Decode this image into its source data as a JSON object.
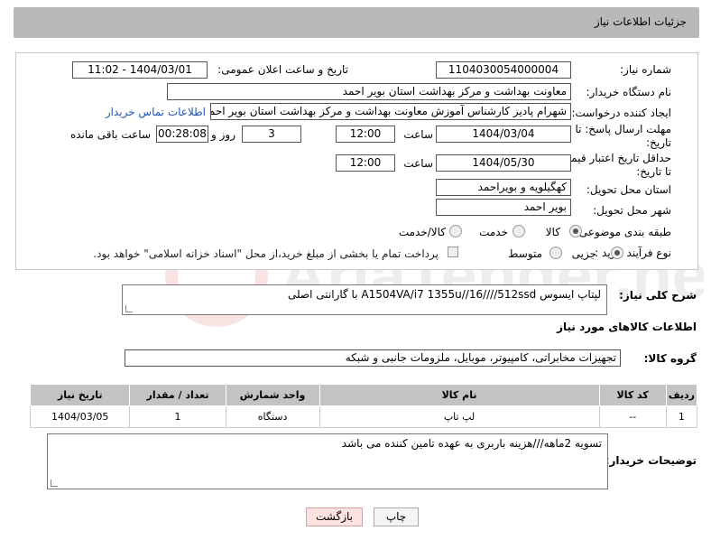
{
  "header": {
    "title": "جزئیات اطلاعات نیاز"
  },
  "form": {
    "need_number_label": "شماره نیاز:",
    "need_number": "1104030054000004",
    "announce_label": "تاریخ و ساعت اعلان عمومی:",
    "announce_value": "1404/03/01 - 11:02",
    "buyer_label": "نام دستگاه خریدار:",
    "buyer_value": "معاونت بهداشت و مرکز بهداشت استان بویر احمد",
    "creator_label": "ایجاد کننده درخواست:",
    "creator_value": "شهرام پادیز کارشناس آموزش معاونت بهداشت و مرکز بهداشت استان بویر احمد",
    "contact_link": "اطلاعات تماس خریدار",
    "deadline_label_1": "مهلت ارسال پاسخ: تا",
    "deadline_label_2": "تاریخ:",
    "deadline_date": "1404/03/04",
    "time_word": "ساعت",
    "deadline_time": "12:00",
    "days_value": "3",
    "days_word": "روز و",
    "remaining_time": "00:28:08",
    "remaining_word": "ساعت باقی مانده",
    "validity_label_1": "حداقل تاریخ اعتبار قیمت:",
    "validity_label_2": "تا تاریخ:",
    "validity_date": "1404/05/30",
    "validity_time": "12:00",
    "province_label": "استان محل تحویل:",
    "province_value": "کهگیلویه و بویراحمد",
    "city_label": "شهر محل تحویل:",
    "city_value": "بویر احمد",
    "category_label": "طبقه بندی موضوعی:",
    "category_options": [
      "کالا",
      "خدمت",
      "کالا/خدمت"
    ],
    "process_label": "نوع فرآیند خرید :",
    "process_options": [
      "جزیی",
      "متوسط"
    ],
    "payment_note": "پرداخت تمام یا بخشی از مبلغ خرید،از محل \"اسناد خزانه اسلامی\" خواهد بود."
  },
  "description": {
    "label": "شرح کلی نیاز:",
    "value": "لپتاپ ایسوس A1504VA/i7 1355u//16////512ssd با گارانتی اصلی"
  },
  "goods": {
    "section_title": "اطلاعات کالاهای مورد نیاز",
    "group_label": "گروه کالا:",
    "group_value": "تجهیزات مخابراتی، کامپیوتر، موبایل، ملزومات جانبی و شبکه",
    "columns": [
      "ردیف",
      "کد کالا",
      "نام کالا",
      "واحد شمارش",
      "تعداد / مقدار",
      "تاریخ نیاز"
    ],
    "rows": [
      [
        "1",
        "--",
        "لپ تاپ",
        "دستگاه",
        "1",
        "1404/03/05"
      ]
    ]
  },
  "buyer_notes": {
    "label": "توضیحات خریدار:",
    "value": "تسویه 2ماهه///هزینه باربری به عهده تامین کننده می باشد"
  },
  "buttons": {
    "print": "چاپ",
    "back": "بازگشت"
  },
  "colors": {
    "header_bg": "#b9b9b9",
    "link": "#2255bb",
    "table_header": "#c3c3c3"
  }
}
